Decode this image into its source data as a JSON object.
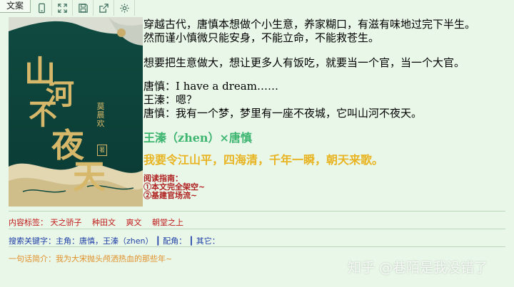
{
  "window": {
    "tab_label": "文案"
  },
  "toolbar": {
    "buttons": [
      {
        "name": "tablet-icon"
      },
      {
        "name": "expand-icon"
      },
      {
        "name": "save-icon"
      },
      {
        "name": "share-icon"
      },
      {
        "name": "gear-icon"
      }
    ]
  },
  "cover": {
    "title_chars": [
      "山",
      "河",
      "不",
      "夜",
      "天"
    ],
    "author": "莫晨欢",
    "author_tag": "著",
    "colors": {
      "bg": "#0f4a40",
      "gold": "#d7b86a"
    }
  },
  "blurb": {
    "p1": "穿越古代，唐慎本想做个小生意，养家糊口，有滋有味地过完下半生。",
    "p2": "然而谨小慎微只能安身，不能立命，不能救苍生。",
    "p3": "想要把生意做大，想让更多人有饭吃，就要当一个官，当一个大官。",
    "d1": "唐慎：I have a dream……",
    "d2": "王溱：嗯？",
    "d3": "唐慎：我有一个梦，梦里有一座不夜城，它叫山河不夜天。"
  },
  "pairing": "王溱（zhen）×唐慎",
  "motto": "我要令江山平，四海清，千年一瞬，朝天来歌。",
  "guide": {
    "title": "阅读指南：",
    "item1": "①本文完全架空~",
    "item2": "②基建官场流~"
  },
  "tags": {
    "label": "内容标签：",
    "values": [
      "天之骄子",
      "种田文",
      "爽文",
      "朝堂之上"
    ]
  },
  "keywords": {
    "text": "搜索关键字：主角：唐慎，王溱（zhen）  ┃ 配角：  ┃ 其它："
  },
  "one_line": {
    "text": "一句话简介：我为大宋抛头颅洒热血的那些年~"
  },
  "watermark": "知乎 @巷陌是我没错了",
  "colors": {
    "page_bg": "#e9f7e9",
    "pairing": "#3cb56f",
    "motto": "#e8b422",
    "guide": "#b01f1f",
    "tags": "#c01818",
    "keywords": "#1f3fa6",
    "one_line": "#e0902a"
  }
}
